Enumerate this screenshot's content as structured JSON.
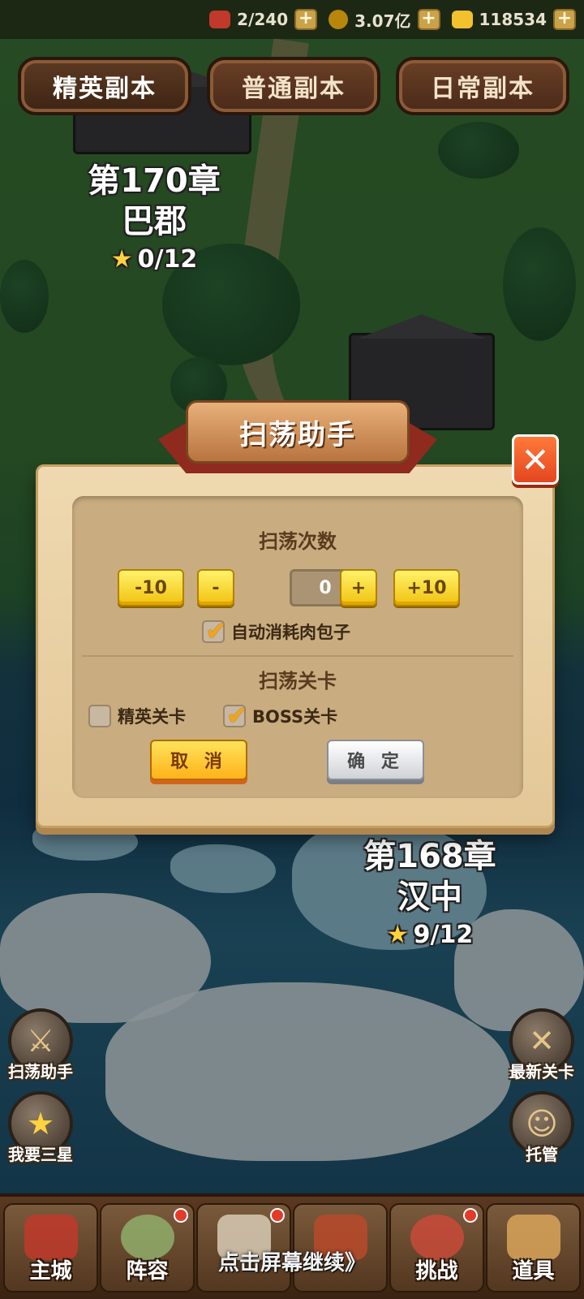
{
  "resources": [
    {
      "icon": "meat-bun-icon",
      "value": "2/240"
    },
    {
      "icon": "copper-coin-icon",
      "value": "3.07亿"
    },
    {
      "icon": "gold-ingot-icon",
      "value": "118534"
    }
  ],
  "tabs": {
    "elite": "精英副本",
    "normal": "普通副本",
    "daily": "日常副本"
  },
  "chapters": {
    "top": {
      "title": "第170章",
      "name": "巴郡",
      "stars": "0/12"
    },
    "bottom": {
      "title": "第168章",
      "name": "汉中",
      "stars": "9/12"
    }
  },
  "side_buttons": {
    "sweep_helper": "扫荡助手",
    "three_star": "我要三星",
    "latest_stage": "最新关卡",
    "auto": "托管"
  },
  "dialog": {
    "title": "扫荡助手",
    "count_title": "扫荡次数",
    "minus10": "-10",
    "minus": "-",
    "count_value": "0",
    "plus": "+",
    "plus10": "+10",
    "auto_consume_label": "自动消耗肉包子",
    "auto_consume_checked": true,
    "stage_title": "扫荡关卡",
    "elite_label": "精英关卡",
    "elite_checked": false,
    "boss_label": "BOSS关卡",
    "boss_checked": true,
    "cancel": "取 消",
    "confirm": "确 定"
  },
  "bottom_nav": [
    {
      "label": "主城",
      "badge": false
    },
    {
      "label": "阵容",
      "badge": true
    },
    {
      "label": "",
      "badge": true
    },
    {
      "label": "",
      "badge": false
    },
    {
      "label": "挑战",
      "badge": true
    },
    {
      "label": "道具",
      "badge": false
    }
  ],
  "continue_hint": "点击屏幕继续》",
  "colors": {
    "accent_yellow": "#f1c20f",
    "close_orange": "#e4461f",
    "ribbon_red": "#8e2a1e",
    "parchment": "#efd9b0"
  }
}
